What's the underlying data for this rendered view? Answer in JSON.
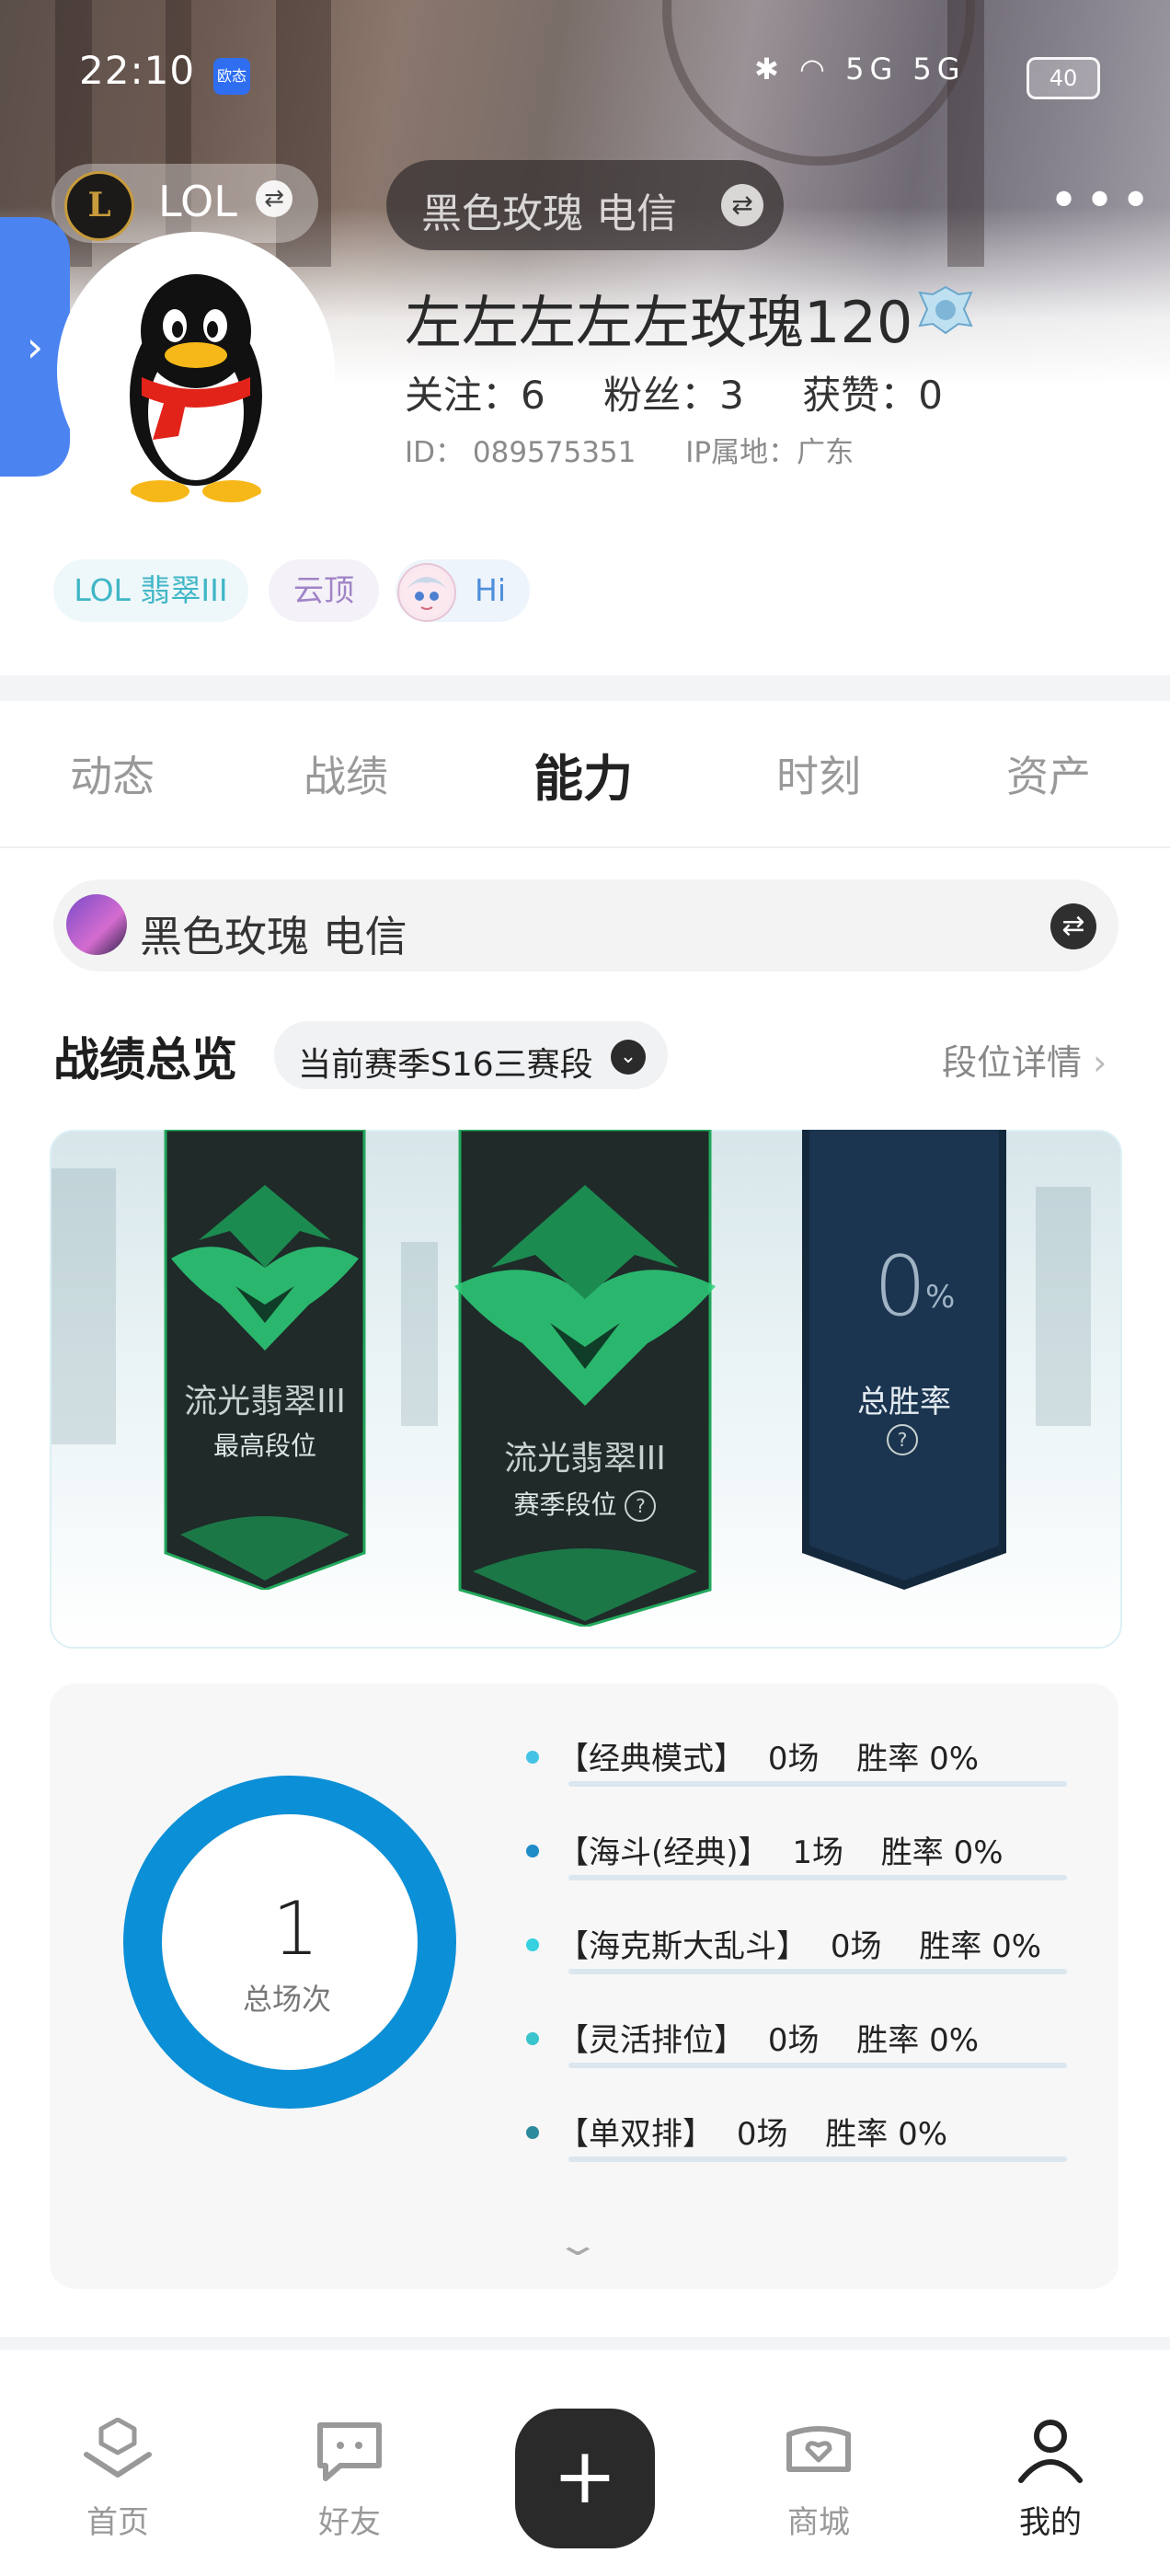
{
  "status_bar": {
    "time": "22:10",
    "badge": "欧态",
    "signal_text": "5G 5G",
    "battery": "40"
  },
  "header": {
    "game_name": "LOL",
    "server": "黑色玫瑰 电信",
    "more_icon": "more-dots-icon"
  },
  "profile": {
    "username": "左左左左左玫瑰120",
    "follow": "关注：6",
    "fans": "粉丝：3",
    "likes": "获赞：0",
    "id": "ID： 089575351",
    "ip": "IP属地：广东"
  },
  "tags": {
    "lol": "LOL 翡翠III",
    "yunding": "云顶",
    "hi": "Hi"
  },
  "tabs": [
    "动态",
    "战绩",
    "能力",
    "时刻",
    "资产"
  ],
  "active_tab": "能力",
  "account": {
    "label": "黑色玫瑰 电信"
  },
  "overview": {
    "title": "战绩总览",
    "season": "当前赛季S16三赛段",
    "rank_detail": "段位详情",
    "highest_rank": "流光翡翠III",
    "highest_label": "最高段位",
    "season_rank": "流光翡翠III",
    "season_label": "赛季段位",
    "winrate_value": "0",
    "winrate_unit": "%",
    "winrate_label": "总胜率"
  },
  "stats": {
    "total": "1",
    "total_label": "总场次",
    "modes": [
      {
        "name": "【经典模式】",
        "count": "0场",
        "rate": "胜率 0%",
        "dot": "#45c3e6"
      },
      {
        "name": "【海斗(经典)】",
        "count": "1场",
        "rate": "胜率 0%",
        "dot": "#1f8cc8"
      },
      {
        "name": "【海克斯大乱斗】",
        "count": "0场",
        "rate": "胜率 0%",
        "dot": "#36d0e0"
      },
      {
        "name": "【灵活排位】",
        "count": "0场",
        "rate": "胜率 0%",
        "dot": "#3ac4cc"
      },
      {
        "name": "【单双排】",
        "count": "0场",
        "rate": "胜率 0%",
        "dot": "#2b8a9c"
      }
    ]
  },
  "nav": {
    "home": "首页",
    "friends": "好友",
    "shop": "商城",
    "mine": "我的"
  },
  "colors": {
    "accent_blue": "#4b84f1",
    "donut": "#0b8fd6",
    "rank_green": "#2ecf7a"
  }
}
